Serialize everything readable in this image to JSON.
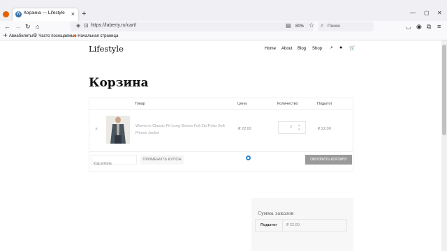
{
  "browser": {
    "tab_title": "Корзина — Lifestyle",
    "url": "https://laberty.ru/cart/",
    "zoom": "80%",
    "search_placeholder": "Поиск",
    "bookmarks": [
      "Авиабилеты",
      "Часто посещаемые",
      "Начальная страница"
    ]
  },
  "site": {
    "logo": "Lifestyle",
    "menu": [
      "Home",
      "About",
      "Blog",
      "Shop"
    ]
  },
  "cart": {
    "title": "Корзина",
    "columns": {
      "product": "Товар",
      "price": "Цена",
      "quantity": "Количество",
      "subtotal": "Подытог"
    },
    "items": [
      {
        "name": "Women's Classic-Fit Long-Sleeve Full-Zip Polar Soft Fleece Jacket",
        "price": "₽ 22.00",
        "quantity": "2",
        "subtotal": "₽ 22.00"
      }
    ],
    "coupon_placeholder": "Код купона",
    "apply_coupon": "ПРИМЕНИТЬ КУПОН",
    "update_cart": "ОБНОВИТЬ КОРЗИНУ"
  },
  "totals": {
    "title": "Сумма заказов",
    "subtotal_label": "Подытог",
    "subtotal_value": "₽ 22.00"
  }
}
